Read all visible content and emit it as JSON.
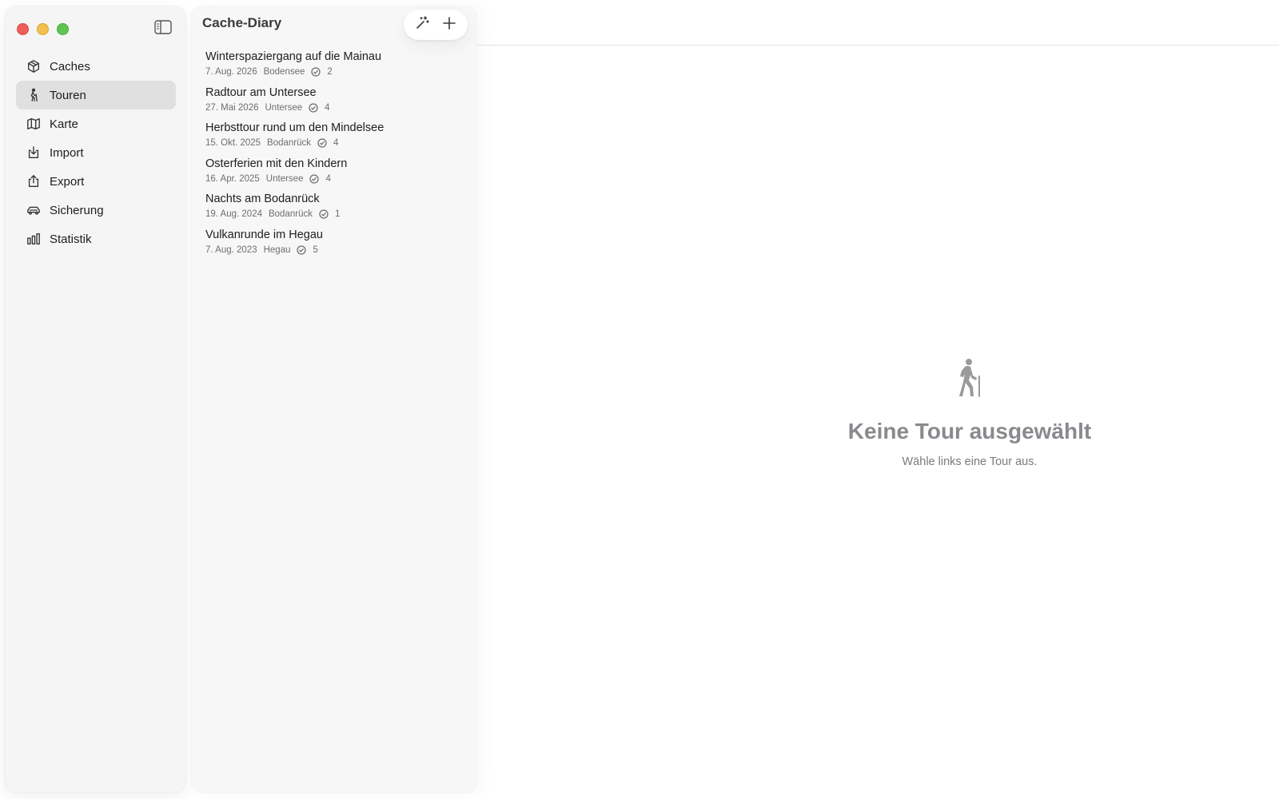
{
  "app": {
    "title": "Cache-Diary"
  },
  "colors": {
    "accent_selected": "#e0e0e0",
    "traffic_red": "#ee5f57",
    "traffic_yellow": "#f4bf4f",
    "traffic_green": "#5fc454"
  },
  "sidebar": {
    "toggle_icon": "sidebar-toggle-icon",
    "items": [
      {
        "label": "Caches",
        "icon": "cube-icon",
        "active": false
      },
      {
        "label": "Touren",
        "icon": "hiker-icon",
        "active": true
      },
      {
        "label": "Karte",
        "icon": "map-icon",
        "active": false
      },
      {
        "label": "Import",
        "icon": "import-icon",
        "active": false
      },
      {
        "label": "Export",
        "icon": "export-icon",
        "active": false
      },
      {
        "label": "Sicherung",
        "icon": "car-icon",
        "active": false
      },
      {
        "label": "Statistik",
        "icon": "bar-chart-icon",
        "active": false
      }
    ]
  },
  "toolbar": {
    "magic_icon": "magic-wand-icon",
    "add_icon": "plus-icon"
  },
  "tours": [
    {
      "name": "Winterspaziergang auf die Mainau",
      "date": "7. Aug. 2026",
      "region": "Bodensee",
      "count": "2"
    },
    {
      "name": "Radtour am Untersee",
      "date": "27. Mai 2026",
      "region": "Untersee",
      "count": "4"
    },
    {
      "name": "Herbsttour rund um den Mindelsee",
      "date": "15. Okt. 2025",
      "region": "Bodanrück",
      "count": "4"
    },
    {
      "name": "Osterferien mit den Kindern",
      "date": "16. Apr. 2025",
      "region": "Untersee",
      "count": "4"
    },
    {
      "name": "Nachts am Bodanrück",
      "date": "19. Aug. 2024",
      "region": "Bodanrück",
      "count": "1"
    },
    {
      "name": "Vulkanrunde im Hegau",
      "date": "7. Aug. 2023",
      "region": "Hegau",
      "count": "5"
    }
  ],
  "detail": {
    "empty_icon": "hiker-icon",
    "empty_title": "Keine Tour ausgewählt",
    "empty_subtitle": "Wähle links eine Tour aus."
  }
}
